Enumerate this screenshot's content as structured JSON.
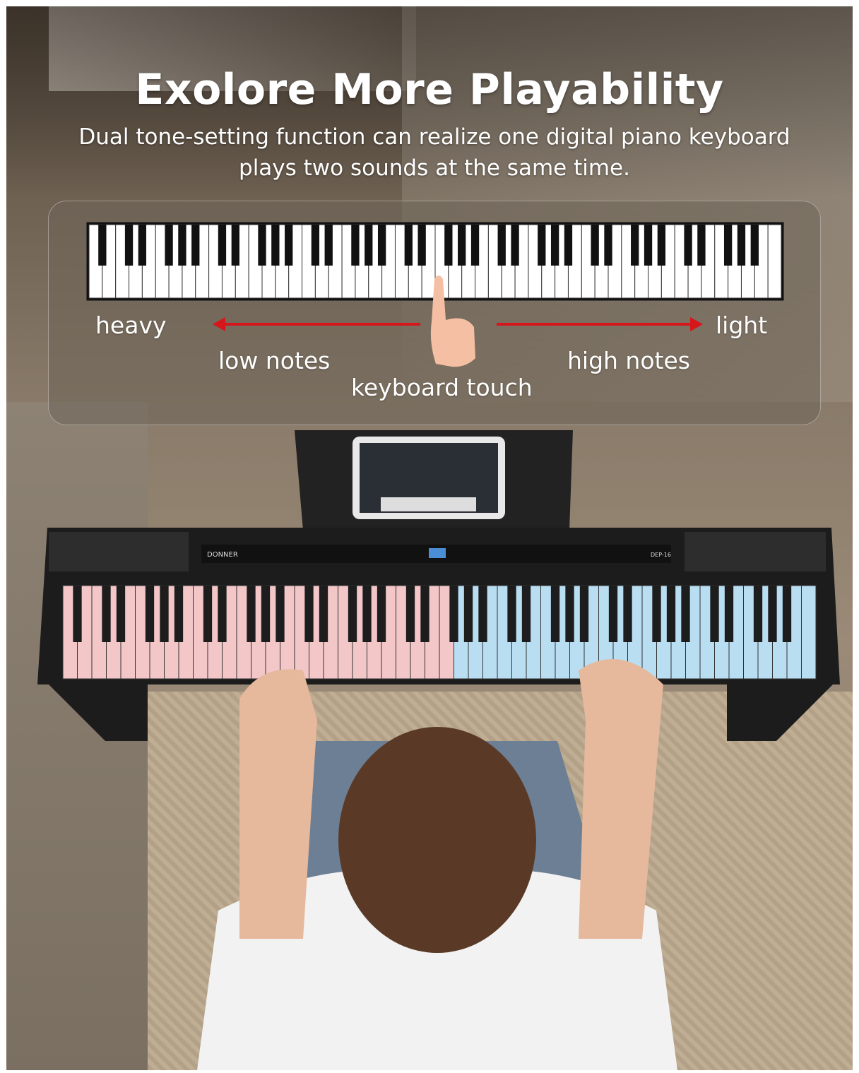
{
  "headline": "Exolore More Playability",
  "subline": "Dual tone-setting function can realize one digital piano keyboard plays two sounds at the same time.",
  "diagram": {
    "label_left": "heavy",
    "label_right": "light",
    "label_low": "low notes",
    "label_high": "high notes",
    "label_center": "keyboard touch",
    "arrow_color": "#d6161a"
  },
  "piano": {
    "brand": "DONNER",
    "model": "DEP-16",
    "left_zone_color": "#f3c6c8",
    "right_zone_color": "#b9def2"
  }
}
